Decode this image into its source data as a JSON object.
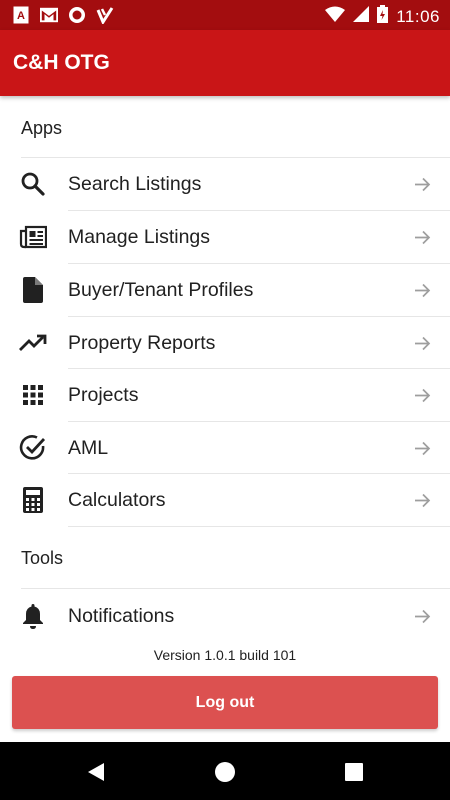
{
  "status_bar": {
    "time": "11:06",
    "left_icons": [
      "pdf-notification-icon",
      "gmail-icon",
      "record-icon",
      "check-notification-icon"
    ],
    "right_icons": [
      "wifi-icon",
      "signal-icon",
      "battery-icon"
    ]
  },
  "app_bar": {
    "title": "C&H OTG"
  },
  "sections": {
    "apps_label": "Apps",
    "tools_label": "Tools"
  },
  "apps": [
    {
      "label": "Search Listings",
      "icon": "search-icon"
    },
    {
      "label": "Manage Listings",
      "icon": "newspaper-icon"
    },
    {
      "label": "Buyer/Tenant Profiles",
      "icon": "document-icon"
    },
    {
      "label": "Property Reports",
      "icon": "trending-up-icon"
    },
    {
      "label": "Projects",
      "icon": "grid-icon"
    },
    {
      "label": "AML",
      "icon": "check-circle-icon"
    },
    {
      "label": "Calculators",
      "icon": "calculator-icon"
    }
  ],
  "tools": [
    {
      "label": "Notifications",
      "icon": "bell-icon"
    }
  ],
  "version": "Version 1.0.1 build 101",
  "logout_label": "Log out",
  "colors": {
    "status_bar": "#a30d0f",
    "app_bar": "#c91517",
    "logout_button": "#dc5150",
    "nav_bar": "#000000"
  }
}
